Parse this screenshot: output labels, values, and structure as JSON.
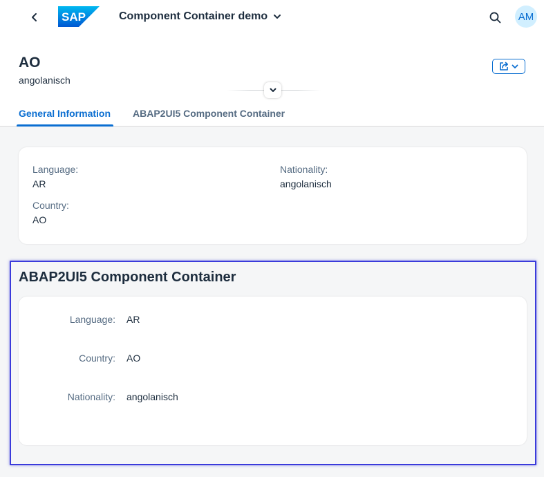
{
  "shell": {
    "app_title": "Component Container demo",
    "logo_text": "SAP",
    "avatar_initials": "AM",
    "brand_color": "#0a6ed1"
  },
  "header": {
    "title": "AO",
    "subtitle": "angolanisch"
  },
  "tabs": [
    {
      "label": "General Information",
      "selected": true
    },
    {
      "label": "ABAP2UI5 Component Container",
      "selected": false
    }
  ],
  "general": {
    "language_label": "Language:",
    "language_value": "AR",
    "nationality_label": "Nationality:",
    "nationality_value": "angolanisch",
    "country_label": "Country:",
    "country_value": "AO"
  },
  "container": {
    "title": "ABAP2UI5 Component Container",
    "language_label": "Language:",
    "language_value": "AR",
    "country_label": "Country:",
    "country_value": "AO",
    "nationality_label": "Nationality:",
    "nationality_value": "angolanisch"
  }
}
